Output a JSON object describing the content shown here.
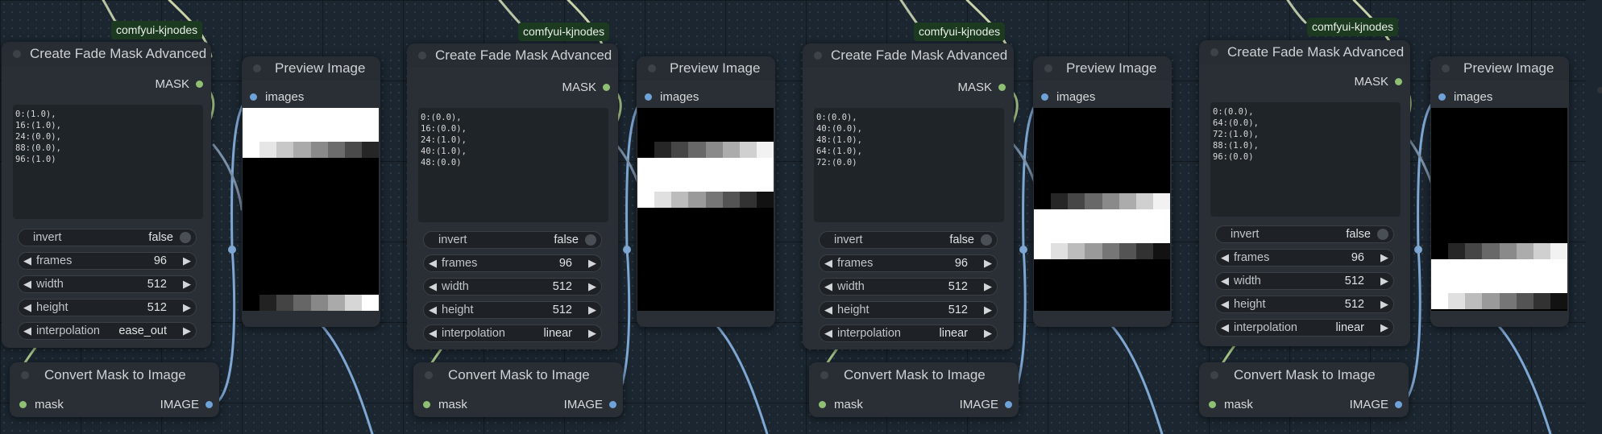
{
  "badge_label": "comfyui-kjnodes",
  "colors": {
    "canvas": "#1b2630",
    "node_body": "#2a2f35",
    "mask_slot": "#8fbf72",
    "image_slot": "#6fa3d8",
    "badge_bg": "#1b3a1f",
    "wire_mask": "#a8c88a",
    "wire_image": "#7fa7d3"
  },
  "groups": [
    {
      "fade": {
        "title": "Create Fade Mask Advanced",
        "output_label": "MASK",
        "points_text": "0:(1.0),\n16:(1.0),\n24:(0.0),\n88:(0.0),\n96:(1.0)",
        "invert": {
          "label": "invert",
          "value": "false"
        },
        "frames": {
          "label": "frames",
          "value": "96"
        },
        "width": {
          "label": "width",
          "value": "512"
        },
        "height": {
          "label": "height",
          "value": "512"
        },
        "interpolation": {
          "label": "interpolation",
          "value": "ease_out"
        }
      },
      "preview": {
        "title": "Preview Image",
        "input_label": "images"
      },
      "convert": {
        "title": "Convert Mask to Image",
        "input_label": "mask",
        "output_label": "IMAGE"
      },
      "badge": "comfyui-kjnodes"
    },
    {
      "fade": {
        "title": "Create Fade Mask Advanced",
        "output_label": "MASK",
        "points_text": "0:(0.0),\n16:(0.0),\n24:(1.0),\n40:(1.0),\n48:(0.0)",
        "invert": {
          "label": "invert",
          "value": "false"
        },
        "frames": {
          "label": "frames",
          "value": "96"
        },
        "width": {
          "label": "width",
          "value": "512"
        },
        "height": {
          "label": "height",
          "value": "512"
        },
        "interpolation": {
          "label": "interpolation",
          "value": "linear"
        }
      },
      "preview": {
        "title": "Preview Image",
        "input_label": "images"
      },
      "convert": {
        "title": "Convert Mask to Image",
        "input_label": "mask",
        "output_label": "IMAGE"
      },
      "badge": "comfyui-kjnodes"
    },
    {
      "fade": {
        "title": "Create Fade Mask Advanced",
        "output_label": "MASK",
        "points_text": "0:(0.0),\n40:(0.0),\n48:(1.0),\n64:(1.0),\n72:(0.0)",
        "invert": {
          "label": "invert",
          "value": "false"
        },
        "frames": {
          "label": "frames",
          "value": "96"
        },
        "width": {
          "label": "width",
          "value": "512"
        },
        "height": {
          "label": "height",
          "value": "512"
        },
        "interpolation": {
          "label": "interpolation",
          "value": "linear"
        }
      },
      "preview": {
        "title": "Preview Image",
        "input_label": "images"
      },
      "convert": {
        "title": "Convert Mask to Image",
        "input_label": "mask",
        "output_label": "IMAGE"
      },
      "badge": "comfyui-kjnodes"
    },
    {
      "fade": {
        "title": "Create Fade Mask Advanced",
        "output_label": "MASK",
        "points_text": "0:(0.0),\n64:(0.0),\n72:(1.0),\n88:(1.0),\n96:(0.0)",
        "invert": {
          "label": "invert",
          "value": "false"
        },
        "frames": {
          "label": "frames",
          "value": "96"
        },
        "width": {
          "label": "width",
          "value": "512"
        },
        "height": {
          "label": "height",
          "value": "512"
        },
        "interpolation": {
          "label": "interpolation",
          "value": "linear"
        }
      },
      "preview": {
        "title": "Preview Image",
        "input_label": "images"
      },
      "convert": {
        "title": "Convert Mask to Image",
        "input_label": "mask",
        "output_label": "IMAGE"
      },
      "badge": "comfyui-kjnodes"
    }
  ]
}
